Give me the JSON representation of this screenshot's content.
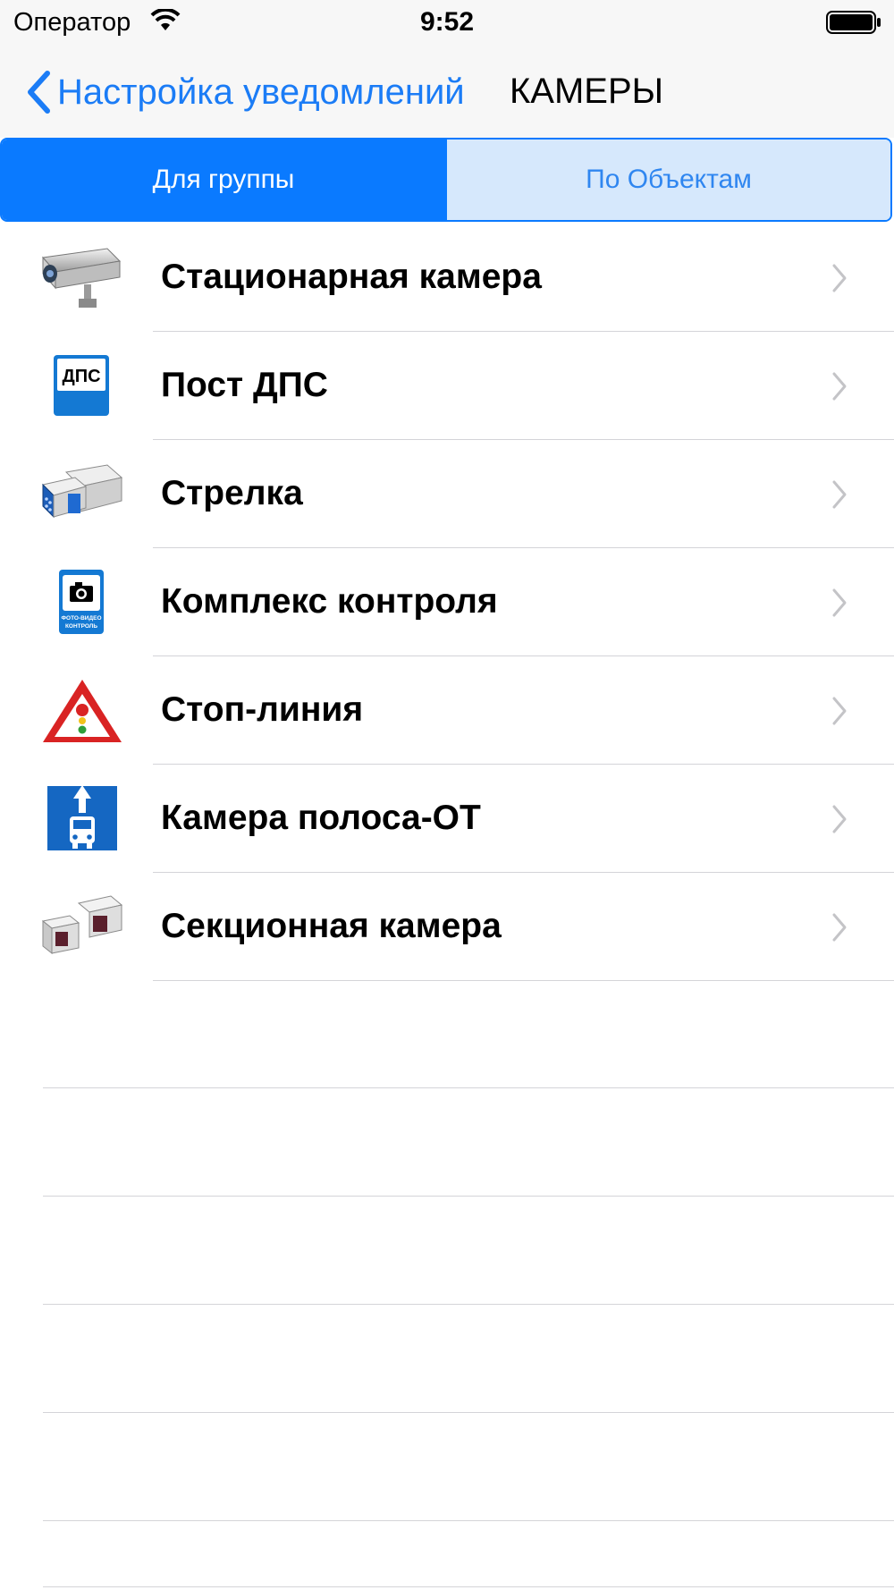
{
  "status_bar": {
    "carrier": "Оператор",
    "time": "9:52"
  },
  "nav": {
    "back_label": "Настройка уведомлений",
    "title": "КАМЕРЫ"
  },
  "segments": {
    "group": "Для группы",
    "objects": "По Объектам"
  },
  "list": [
    {
      "label": "Стационарная камера",
      "icon": "stationary-camera-icon"
    },
    {
      "label": "Пост ДПС",
      "icon": "dps-post-sign-icon",
      "sign_text": "ДПС"
    },
    {
      "label": "Стрелка",
      "icon": "strelka-radar-icon"
    },
    {
      "label": "Комплекс контроля",
      "icon": "photo-video-control-sign-icon",
      "sign_text": [
        "ФОТО-ВИДЕО",
        "КОНТРОЛЬ"
      ]
    },
    {
      "label": "Стоп-линия",
      "icon": "traffic-light-warning-sign-icon"
    },
    {
      "label": "Камера полоса-ОТ",
      "icon": "bus-lane-sign-icon"
    },
    {
      "label": "Секционная камера",
      "icon": "section-camera-icon"
    }
  ],
  "colors": {
    "accent": "#0a7aff",
    "segment_inactive_bg": "#d6e8fc",
    "separator": "#d4d4d8"
  }
}
